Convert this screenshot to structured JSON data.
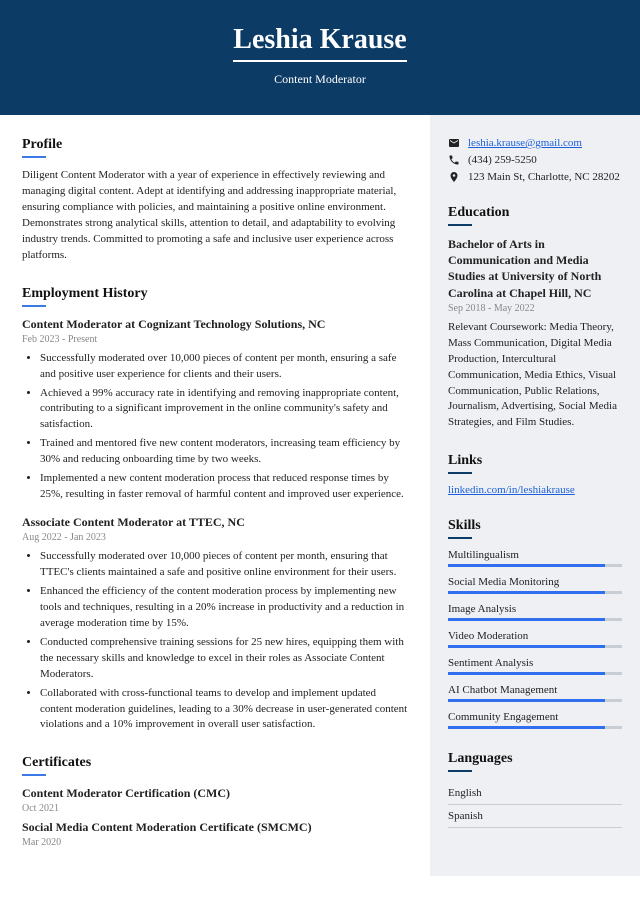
{
  "header": {
    "name": "Leshia Krause",
    "title": "Content Moderator"
  },
  "profile": {
    "heading": "Profile",
    "text": "Diligent Content Moderator with a year of experience in effectively reviewing and managing digital content. Adept at identifying and addressing inappropriate material, ensuring compliance with policies, and maintaining a positive online environment. Demonstrates strong analytical skills, attention to detail, and adaptability to evolving industry trends. Committed to promoting a safe and inclusive user experience across platforms."
  },
  "employment": {
    "heading": "Employment History",
    "jobs": [
      {
        "title": "Content Moderator at Cognizant Technology Solutions, NC",
        "dates": "Feb 2023 - Present",
        "bullets": [
          "Successfully moderated over 10,000 pieces of content per month, ensuring a safe and positive user experience for clients and their users.",
          "Achieved a 99% accuracy rate in identifying and removing inappropriate content, contributing to a significant improvement in the online community's safety and satisfaction.",
          "Trained and mentored five new content moderators, increasing team efficiency by 30% and reducing onboarding time by two weeks.",
          "Implemented a new content moderation process that reduced response times by 25%, resulting in faster removal of harmful content and improved user experience."
        ]
      },
      {
        "title": "Associate Content Moderator at TTEC, NC",
        "dates": "Aug 2022 - Jan 2023",
        "bullets": [
          "Successfully moderated over 10,000 pieces of content per month, ensuring that TTEC's clients maintained a safe and positive online environment for their users.",
          "Enhanced the efficiency of the content moderation process by implementing new tools and techniques, resulting in a 20% increase in productivity and a reduction in average moderation time by 15%.",
          "Conducted comprehensive training sessions for 25 new hires, equipping them with the necessary skills and knowledge to excel in their roles as Associate Content Moderators.",
          "Collaborated with cross-functional teams to develop and implement updated content moderation guidelines, leading to a 30% decrease in user-generated content violations and a 10% improvement in overall user satisfaction."
        ]
      }
    ]
  },
  "certificates": {
    "heading": "Certificates",
    "items": [
      {
        "title": "Content Moderator Certification (CMC)",
        "date": "Oct 2021"
      },
      {
        "title": "Social Media Content Moderation Certificate (SMCMC)",
        "date": "Mar 2020"
      }
    ]
  },
  "contact": {
    "email": "leshia.krause@gmail.com",
    "phone": "(434) 259-5250",
    "address": "123 Main St, Charlotte, NC 28202"
  },
  "education": {
    "heading": "Education",
    "degree": "Bachelor of Arts in Communication and Media Studies at University of North Carolina at Chapel Hill, NC",
    "dates": "Sep 2018 - May 2022",
    "coursework": "Relevant Coursework: Media Theory, Mass Communication, Digital Media Production, Intercultural Communication, Media Ethics, Visual Communication, Public Relations, Journalism, Advertising, Social Media Strategies, and Film Studies."
  },
  "links": {
    "heading": "Links",
    "items": [
      "linkedin.com/in/leshiakrause"
    ]
  },
  "skills": {
    "heading": "Skills",
    "items": [
      {
        "name": "Multilingualism",
        "level": 90
      },
      {
        "name": "Social Media Monitoring",
        "level": 90
      },
      {
        "name": "Image Analysis",
        "level": 90
      },
      {
        "name": "Video Moderation",
        "level": 90
      },
      {
        "name": "Sentiment Analysis",
        "level": 90
      },
      {
        "name": "AI Chatbot Management",
        "level": 90
      },
      {
        "name": "Community Engagement",
        "level": 90
      }
    ]
  },
  "languages": {
    "heading": "Languages",
    "items": [
      "English",
      "Spanish"
    ]
  }
}
